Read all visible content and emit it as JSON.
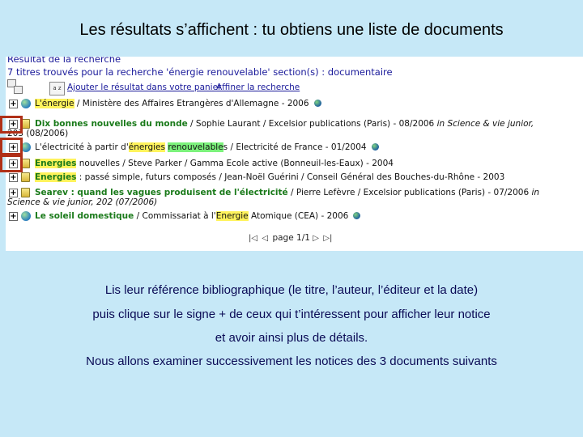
{
  "slide": {
    "title": "Les résultats s’affichent : tu obtiens une liste de documents",
    "paragraphs": [
      "Lis leur référence bibliographique (le titre, l’auteur, l’éditeur et la date)",
      "puis clique sur le signe + de ceux qui t’intéressent pour afficher leur notice",
      "et avoir ainsi plus de détails.",
      "Nous allons examiner successivement les notices des 3 documents suivants"
    ]
  },
  "search": {
    "heading": "Résultat de la recherche",
    "summary": "7 titres trouvés pour la recherche 'énergie renouvelable' section(s) : documentaire",
    "basket_link": "Ajouter le résultat dans votre panier",
    "refine_link": "Affiner la recherche",
    "tb_icon_text": "a z",
    "plus_sign": "+"
  },
  "results": [
    {
      "pre": "",
      "hl1": "L'énergie",
      "post1": "",
      "hl2": "",
      "post2": " / Ministère des Affaires Etrangères d'Allemagne - 2006",
      "cont": ""
    },
    {
      "pre": "Dix bonnes nouvelles du monde",
      "hl1": "",
      "post1": " / Sophie Laurant / Excelsior publications (Paris) - 08/2006 ",
      "em": "in Science & vie junior,",
      "hl2": "",
      "post2": "",
      "cont": "203 (08/2006)"
    },
    {
      "pre": "L'électricité à partir d'",
      "hl1": "énergies",
      "post1": " ",
      "hl2": "renouvelable",
      "post2": "s / Electricité de France - 01/2004",
      "cont": ""
    },
    {
      "pre": "",
      "hl1": "Energies",
      "post1": " nouvelles / Steve Parker / Gamma Ecole active (Bonneuil-les-Eaux) - 2004",
      "hl2": "",
      "post2": "",
      "cont": ""
    },
    {
      "pre": "",
      "hl1": "Energies",
      "post1": " : passé simple, futurs composés / Jean-Noël Guérini / Conseil Général des Bouches-du-Rhône - 2003",
      "hl2": "",
      "post2": "",
      "cont": ""
    },
    {
      "pre": "Searev : quand les vagues produisent de l'électricité",
      "hl1": "",
      "post1": " / Pierre Lefèvre / Excelsior publications (Paris) - 07/2006 ",
      "em": "in",
      "hl2": "",
      "post2": "",
      "cont": "Science & vie junior, 202 (07/2006)"
    },
    {
      "pre": "Le soleil domestique",
      "hl1": "",
      "post1": " / Commissariat à l'",
      "hl2": "Energie",
      "post2": " Atomique (CEA) - 2006",
      "cont": ""
    }
  ],
  "pager": {
    "label": "page 1/1"
  },
  "colors": {
    "slide_bg": "#c6e8f7",
    "annotation": "#b03018",
    "highlight": "#fff35c",
    "highlight_green": "#7cf27c"
  }
}
